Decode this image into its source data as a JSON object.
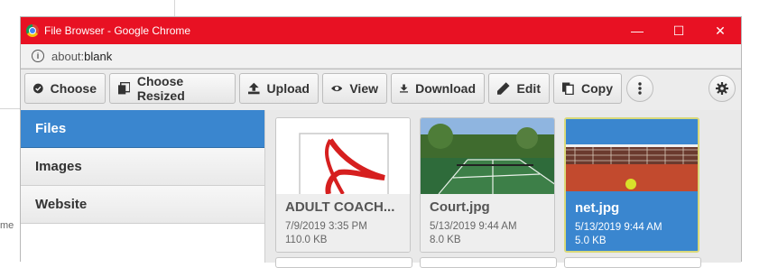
{
  "window": {
    "title": "File Browser - Google Chrome",
    "controls": [
      "—",
      "☐",
      "✕"
    ]
  },
  "address": {
    "prefix": "about:",
    "rest": "blank"
  },
  "toolbar": {
    "choose": "Choose",
    "choose_resized": "Choose Resized",
    "upload": "Upload",
    "view": "View",
    "download": "Download",
    "edit": "Edit",
    "copy": "Copy"
  },
  "sidebar": {
    "items": [
      {
        "label": "Files",
        "active": true
      },
      {
        "label": "Images",
        "active": false
      },
      {
        "label": "Website",
        "active": false
      }
    ]
  },
  "files": [
    {
      "name": "ADULT COACH...",
      "date": "7/9/2019 3:35 PM",
      "size": "110.0 KB",
      "selected": false,
      "icon": "pdf-icon"
    },
    {
      "name": "Court.jpg",
      "date": "5/13/2019 9:44 AM",
      "size": "8.0 KB",
      "selected": false,
      "icon": "tennis-court-image"
    },
    {
      "name": "net.jpg",
      "date": "5/13/2019 9:44 AM",
      "size": "5.0 KB",
      "selected": true,
      "icon": "tennis-net-image"
    }
  ],
  "background": {
    "fragment": "me"
  },
  "colors": {
    "titlebar": "#e81123",
    "accent": "#3a86cf"
  }
}
